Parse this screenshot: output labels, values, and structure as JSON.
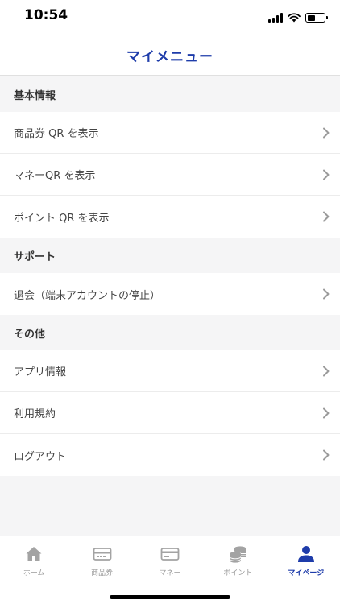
{
  "status": {
    "time": "10:54"
  },
  "header": {
    "title": "マイメニュー"
  },
  "sections": [
    {
      "title": "基本情報",
      "items": [
        "商品券 QR を表示",
        "マネーQR を表示",
        "ポイント QR を表示"
      ]
    },
    {
      "title": "サポート",
      "items": [
        "退会（端末アカウントの停止）"
      ]
    },
    {
      "title": "その他",
      "items": [
        "アプリ情報",
        "利用規約",
        "ログアウト"
      ]
    }
  ],
  "tabs": [
    {
      "label": "ホーム",
      "icon": "home-icon"
    },
    {
      "label": "商品券",
      "icon": "voucher-card-icon"
    },
    {
      "label": "マネー",
      "icon": "money-card-icon"
    },
    {
      "label": "ポイント",
      "icon": "coins-icon"
    },
    {
      "label": "マイページ",
      "icon": "person-icon"
    }
  ],
  "colors": {
    "accent": "#1e3caa",
    "inactive": "#9a9a9a",
    "background": "#f5f5f6"
  }
}
